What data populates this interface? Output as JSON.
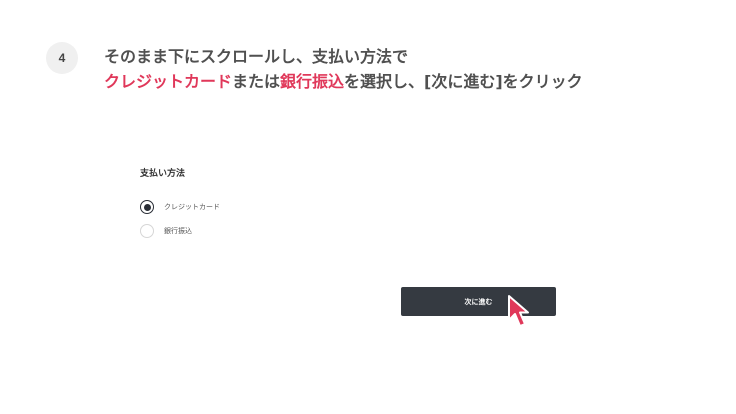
{
  "step": {
    "number": "4"
  },
  "instruction": {
    "line1": "そのまま下にスクロールし、支払い方法で",
    "line2_hl1": "クレジットカード",
    "line2_mid": "または",
    "line2_hl2": "銀行振込",
    "line2_end": "を選択し、[次に進む]をクリック"
  },
  "form": {
    "payment_heading": "支払い方法",
    "options": [
      {
        "label": "クレジットカード",
        "selected": true
      },
      {
        "label": "銀行振込",
        "selected": false
      }
    ],
    "next_button_label": "次に進む"
  },
  "colors": {
    "highlight": "#e0385a",
    "button_bg": "#353a41",
    "cursor": "#e0385a"
  },
  "icons": {
    "pointer": "mouse-pointer-icon"
  }
}
